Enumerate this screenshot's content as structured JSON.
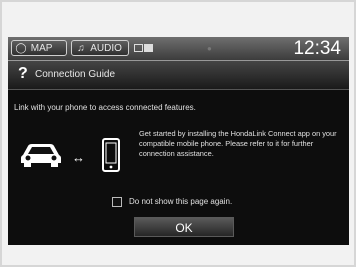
{
  "topbar": {
    "map_label": "MAP",
    "audio_label": "AUDIO",
    "clock": "12:34"
  },
  "icons": {
    "map": "navigation-circle-icon",
    "audio": "music-note-icon",
    "help": "question-mark-icon",
    "car": "car-icon",
    "link": "double-arrow-icon",
    "phone": "smartphone-icon"
  },
  "dialog": {
    "title_icon": "?",
    "title": "Connection Guide",
    "link_text": "Link with your phone to access connected features.",
    "description": "Get started by installing the HondaLink Connect app on your compatible mobile phone. Please refer to it for further connection assistance.",
    "checkbox_label": "Do not show this page again.",
    "checkbox_checked": false,
    "ok_label": "OK"
  }
}
